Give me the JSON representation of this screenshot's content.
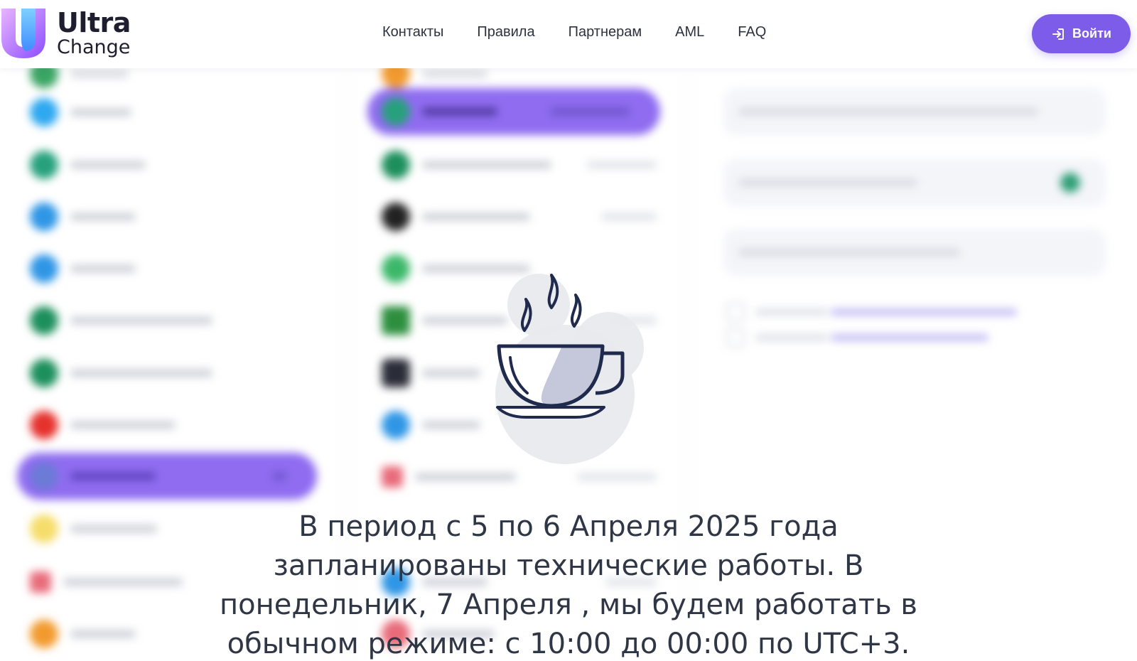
{
  "header": {
    "logo": {
      "line1": "Ultra",
      "line2": "Change"
    },
    "nav": [
      {
        "label": "Контакты"
      },
      {
        "label": "Правила"
      },
      {
        "label": "Партнерам"
      },
      {
        "label": "AML"
      },
      {
        "label": "FAQ"
      }
    ],
    "login_label": "Войти"
  },
  "maintenance": {
    "message": "В период с 5 по 6 Апреля 2025 года запланированы технические работы. В понедельник, 7 Апреля , мы будем работать в обычном режиме: с 10:00 до 00:00 по UTC+3."
  },
  "colors": {
    "accent": "#7c5ce8",
    "text_dark": "#2f3645",
    "cup_stroke": "#1f2a4d",
    "cup_fill": "#c5c8da",
    "bubble": "#e7e9ee"
  },
  "icons": {
    "login": "login-arrow-icon",
    "cup": "coffee-cup-icon"
  }
}
